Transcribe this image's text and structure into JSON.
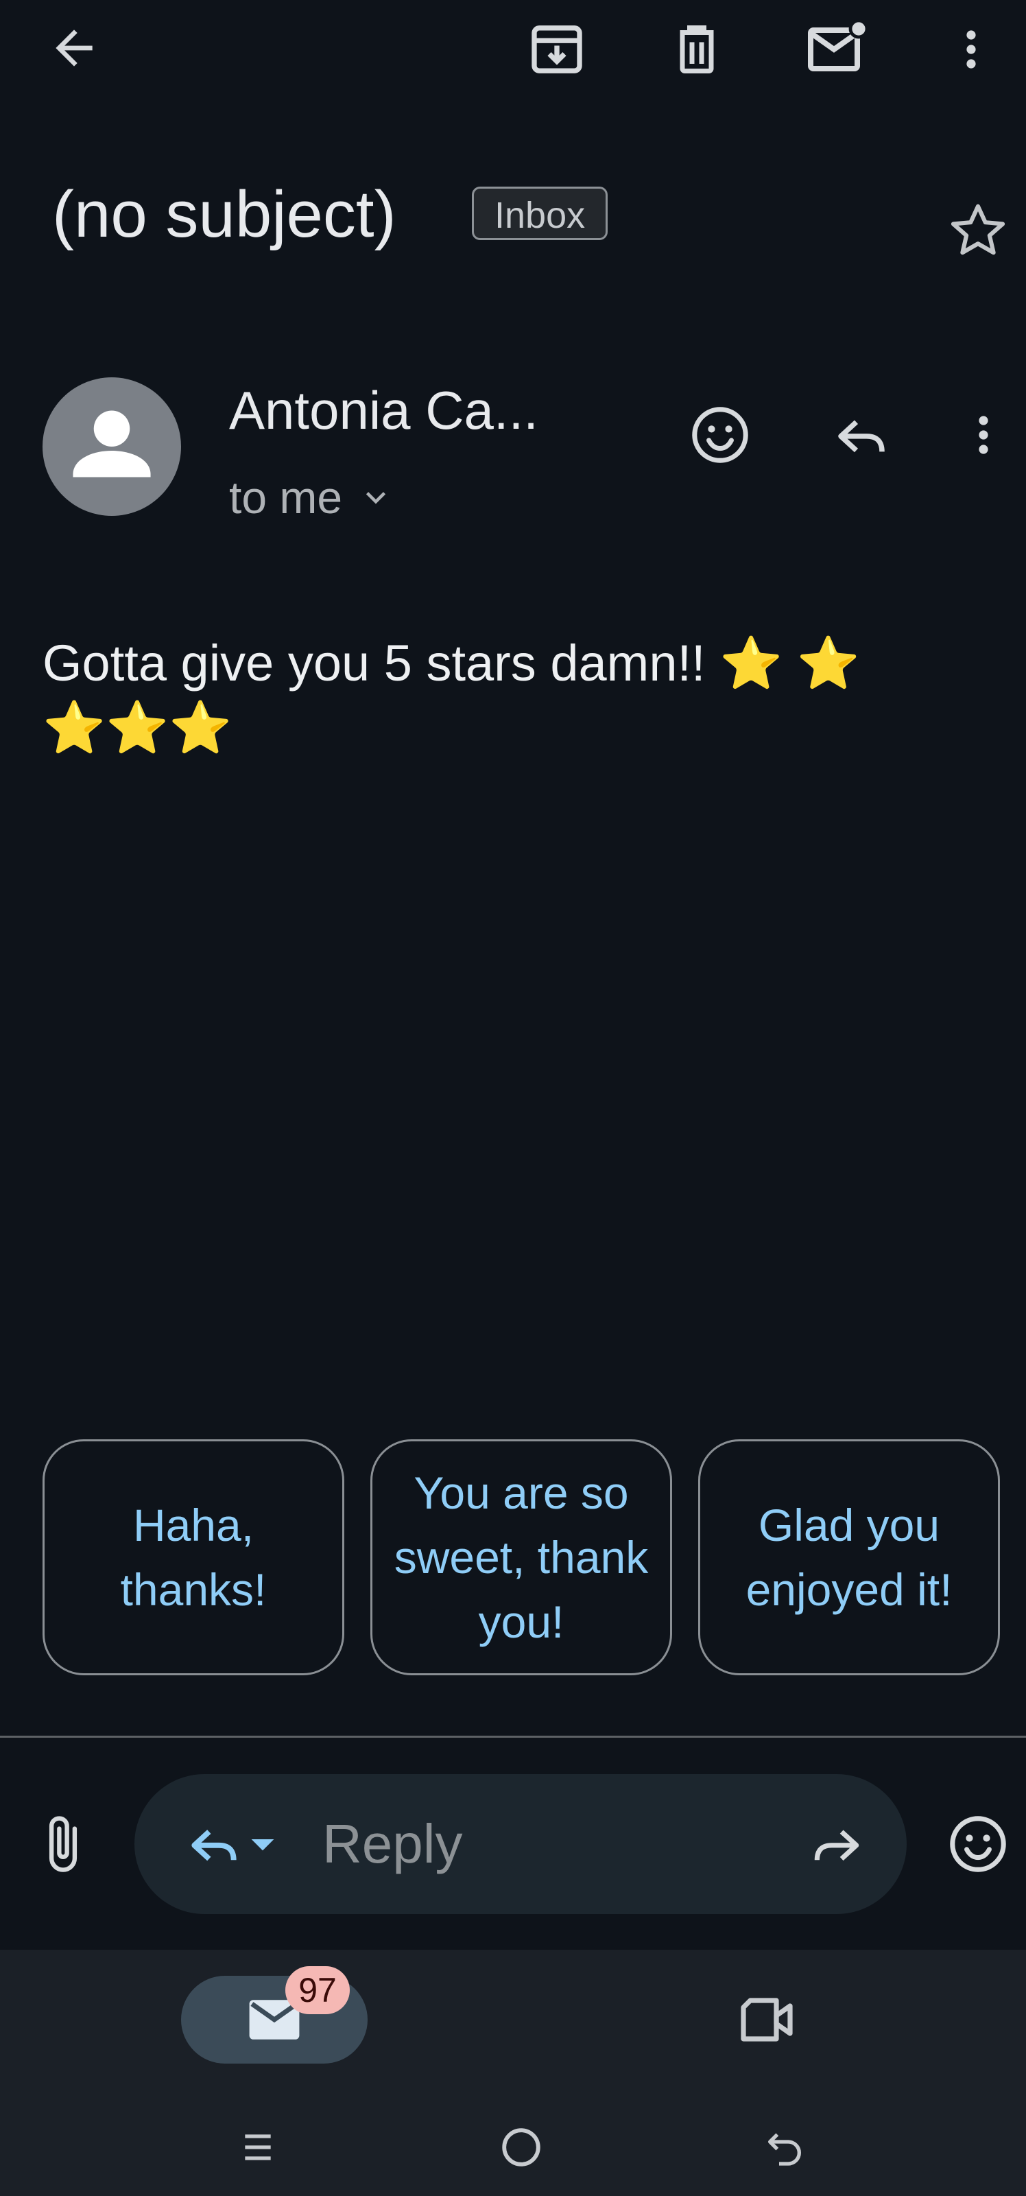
{
  "toolbar": {
    "back_icon": "arrow-left-icon",
    "archive_icon": "archive-icon",
    "delete_icon": "trash-icon",
    "mark_unread_icon": "mail-unread-icon",
    "more_icon": "more-vert-icon"
  },
  "email": {
    "subject": "(no subject)",
    "label": "Inbox",
    "starred": false,
    "sender_name": "Antonia Ca...",
    "recipient": "to me",
    "body": "Gotta give you 5 stars damn!! ⭐ ⭐ ⭐⭐⭐"
  },
  "smart_replies": [
    {
      "label": "Haha, thanks!"
    },
    {
      "label": "You are so sweet, thank you!"
    },
    {
      "label": "Glad you enjoyed it!"
    }
  ],
  "reply_bar": {
    "placeholder": "Reply"
  },
  "bottom_nav": {
    "mail_badge": "97"
  },
  "colors": {
    "background": "#0e131a",
    "accent_blue": "#8fcdf7",
    "badge_bg": "#f5b8b4",
    "star_yellow": "#fbbc04"
  }
}
